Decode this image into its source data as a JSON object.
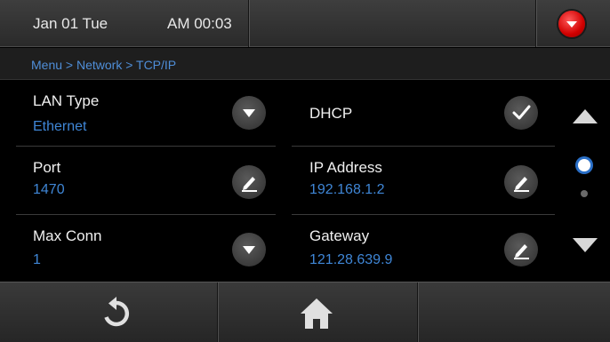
{
  "header": {
    "date": "Jan 01 Tue",
    "time": "AM 00:03",
    "dropdown_icon": "red-triangle-down-icon"
  },
  "breadcrumb": "Menu > Network > TCP/IP",
  "settings": {
    "lan_type": {
      "label": "LAN Type",
      "value": "Ethernet",
      "action_icon": "chevron-down-icon"
    },
    "dhcp": {
      "label": "DHCP",
      "checked": true,
      "action_icon": "checkmark-icon"
    },
    "port": {
      "label": "Port",
      "value": "1470",
      "action_icon": "edit-pencil-icon"
    },
    "ip_address": {
      "label": "IP Address",
      "value": "192.168.1.2",
      "action_icon": "edit-pencil-icon"
    },
    "max_conn": {
      "label": "Max Conn",
      "value": "1",
      "action_icon": "chevron-down-icon"
    },
    "gateway": {
      "label": "Gateway",
      "value": "121.28.639.9",
      "action_icon": "edit-pencil-icon"
    }
  },
  "pagination": {
    "current_page": 1,
    "total_pages": 2
  },
  "bottom_bar": {
    "left_icon": "refresh-icon",
    "center_icon": "home-icon"
  },
  "colors": {
    "accent_blue": "#3f86d6",
    "alert_red": "#d10000",
    "background": "#000000"
  }
}
